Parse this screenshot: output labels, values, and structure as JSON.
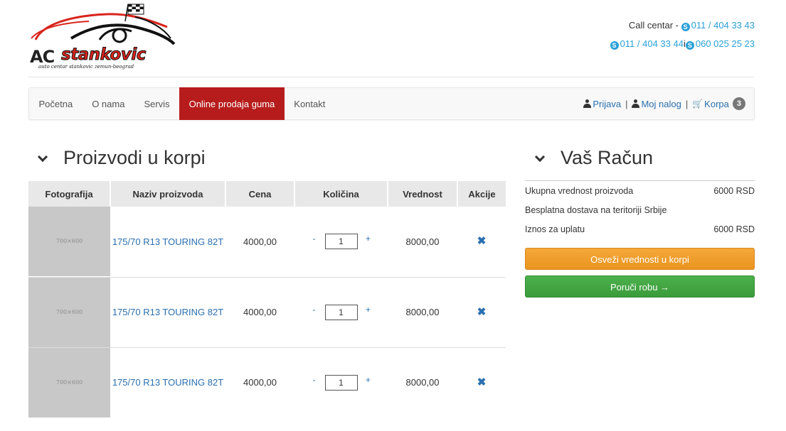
{
  "logo": {
    "ac": "AC",
    "name": "stankovic",
    "tagline": "auto centar stankovic zemun-beograd"
  },
  "contact": {
    "label": "Call centar -",
    "phones": [
      "011 / 404 33 43",
      "011 / 404 33 44",
      "060 025 25 23"
    ],
    "joiner": "i",
    "icon": "skype-icon"
  },
  "nav": {
    "items": [
      {
        "label": "Početna",
        "active": false
      },
      {
        "label": "O nama",
        "active": false
      },
      {
        "label": "Servis",
        "active": false
      },
      {
        "label": "Online prodaja guma",
        "active": true
      },
      {
        "label": "Kontakt",
        "active": false
      }
    ],
    "login": "Prijava",
    "account": "Moj nalog",
    "cart": "Korpa",
    "cart_count": "3",
    "separator": "|"
  },
  "cart": {
    "title": "Proizvodi u korpi",
    "columns": [
      "Fotografija",
      "Naziv proizvoda",
      "Cena",
      "Količina",
      "Vrednost",
      "Akcije"
    ],
    "rows": [
      {
        "photo": "700×600",
        "name": "175/70 R13 TOURING 82T",
        "price": "4000,00",
        "qty": "1",
        "total": "8000,00"
      },
      {
        "photo": "700×600",
        "name": "175/70 R13 TOURING 82T",
        "price": "4000,00",
        "qty": "1",
        "total": "8000,00"
      },
      {
        "photo": "700×600",
        "name": "175/70 R13 TOURING 82T",
        "price": "4000,00",
        "qty": "1",
        "total": "8000,00"
      }
    ],
    "minus": "-",
    "plus": "+",
    "remove": "✖"
  },
  "summary": {
    "title": "Vaš Račun",
    "products_label": "Ukupna vrednost proizvoda",
    "products_value": "6000 RSD",
    "shipping_label": "Besplatna dostava na teritoriji Srbije",
    "pay_label": "Iznos za uplatu",
    "pay_value": "6000 RSD",
    "refresh_button": "Osveži vrednosti u korpi",
    "order_button": "Poruči robu →"
  },
  "colors": {
    "brand_red": "#b71c1c",
    "link_blue": "#2a6fb0",
    "phone_blue": "#2aa0d8",
    "orange": "#ec9a27",
    "green": "#43a843"
  }
}
